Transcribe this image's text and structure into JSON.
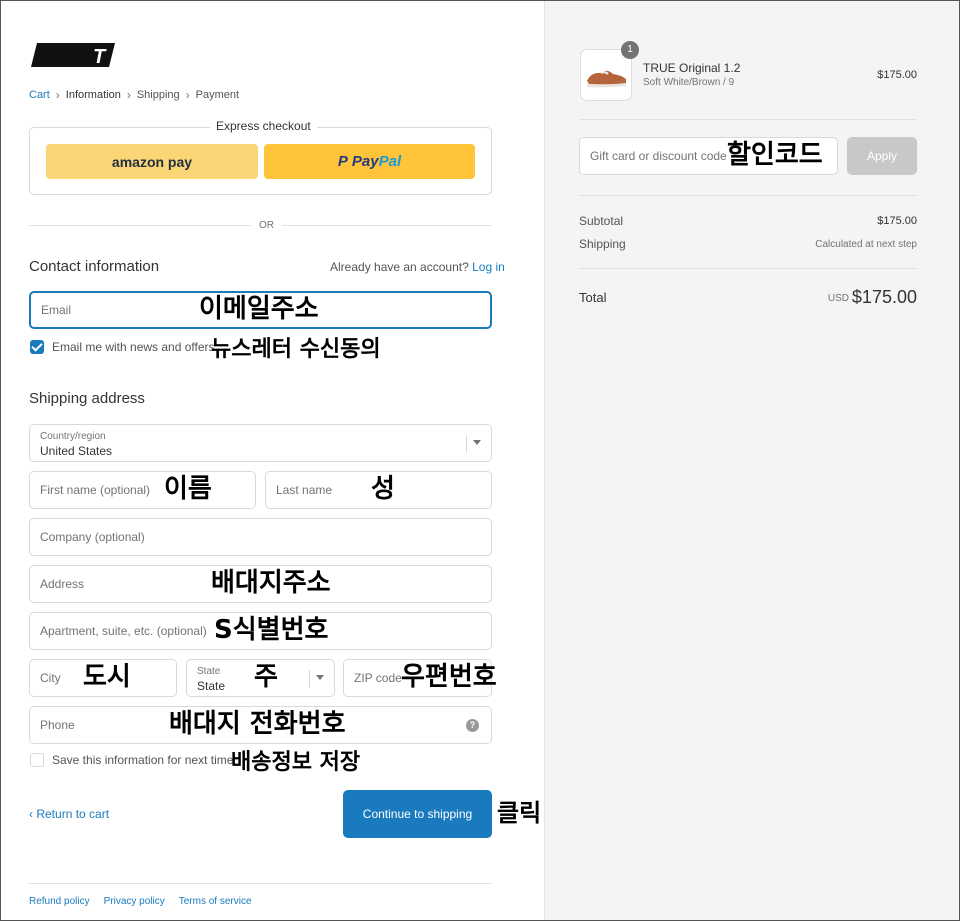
{
  "brand": {
    "logo_letter": "T"
  },
  "breadcrumb": {
    "cart": "Cart",
    "information": "Information",
    "shipping": "Shipping",
    "payment": "Payment"
  },
  "express": {
    "title": "Express checkout",
    "amazon_label": "amazon pay",
    "paypal_pay": "Pay",
    "paypal_pal": "Pal"
  },
  "or_text": "OR",
  "contact": {
    "title": "Contact information",
    "have_account": "Already have an account?",
    "login": "Log in",
    "email_placeholder": "Email",
    "email_note": "이메일주소",
    "news_label": "Email me with news and offers",
    "news_checked": true,
    "news_note": "뉴스레터 수신동의"
  },
  "shipping": {
    "title": "Shipping address",
    "country_label": "Country/region",
    "country_value": "United States",
    "first_name": "First name (optional)",
    "first_name_note": "이름",
    "last_name": "Last name",
    "last_name_note": "성",
    "company": "Company (optional)",
    "address": "Address",
    "address_note": "배대지주소",
    "apartment": "Apartment, suite, etc. (optional)",
    "apartment_note": "S식별번호",
    "city": "City",
    "city_note": "도시",
    "state_label": "State",
    "state_value": "State",
    "state_note": "주",
    "zip": "ZIP code",
    "zip_note": "우편번호",
    "phone": "Phone",
    "phone_note": "배대지 전화번호",
    "save_label": "Save this information for next time",
    "save_checked": false,
    "save_note": "배송정보 저장"
  },
  "actions": {
    "return_label": "Return to cart",
    "continue_label": "Continue to shipping",
    "continue_note": "클릭"
  },
  "footer": {
    "refund": "Refund policy",
    "privacy": "Privacy policy",
    "terms": "Terms of service"
  },
  "order": {
    "quantity": "1",
    "product_name": "TRUE Original 1.2",
    "product_variant": "Soft White/Brown / 9",
    "product_price": "$175.00",
    "gift_placeholder": "Gift card or discount code",
    "gift_note": "할인코드",
    "apply_label": "Apply",
    "subtotal_label": "Subtotal",
    "subtotal_value": "$175.00",
    "shipping_label": "Shipping",
    "shipping_value": "Calculated at next step",
    "total_label": "Total",
    "total_currency": "USD",
    "total_value": "$175.00"
  },
  "colors": {
    "accent": "#197bbd",
    "amazon": "#fad677",
    "paypal": "#ffc43a",
    "checkbox": "#197bbd"
  }
}
